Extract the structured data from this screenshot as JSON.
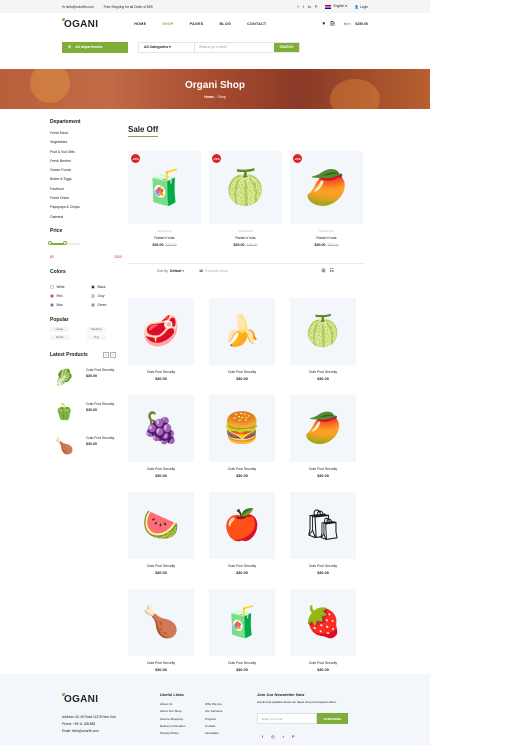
{
  "topbar": {
    "email": "hello@colorlib.com",
    "shipping": "Free Shipping for all Order of $99",
    "social": [
      "f",
      "t",
      "in",
      "P"
    ],
    "language": "English",
    "login": "Login"
  },
  "header": {
    "logo": "OGANI",
    "nav": [
      "HOME",
      "SHOP",
      "PAGES",
      "BLOG",
      "CONTACT"
    ],
    "item_label": "item:",
    "cart_total": "$150.00",
    "wishlist_count": "1",
    "cart_count": "3"
  },
  "search": {
    "departments_label": "All departments",
    "category": "All Categories",
    "placeholder": "What do yo u need?",
    "button": "SEARCH"
  },
  "hero": {
    "title": "Organi Shop",
    "breadcrumb_home": "Home",
    "breadcrumb_current": "Shop"
  },
  "sidebar": {
    "department_title": "Departement",
    "departments": [
      "Fresh Meat",
      "Vegetables",
      "Fruit & Nut Gifts",
      "Fresh Berries",
      "Ocean Foods",
      "Butter & Eggs",
      "Fastfood",
      "Fresh Onion",
      "Papayaya & Crisps",
      "Oatmeal"
    ],
    "price_title": "Price",
    "price_min": "$0",
    "price_max": "$100",
    "price_range": [
      0.0,
      0.5
    ],
    "colors_title": "Colors",
    "colors": [
      {
        "label": "White",
        "color": "#ffffff"
      },
      {
        "label": "Black",
        "color": "#1c1c1c"
      },
      {
        "label": "Red",
        "color": "#dd2222"
      },
      {
        "label": "Gray",
        "color": "#c4c4c4"
      },
      {
        "label": "Blue",
        "color": "#3c65dd"
      },
      {
        "label": "Green",
        "color": "#7fad39"
      }
    ],
    "popular_title": "Popular",
    "sizes": [
      "Large",
      "Medium",
      "Small",
      "Tiny"
    ],
    "latest_title": "Latest Products",
    "latest": [
      {
        "name": "Crab Pool Security",
        "price": "$30.00",
        "icon": "spinach-icon"
      },
      {
        "name": "Crab Pool Security",
        "price": "$30.00",
        "icon": "bell-pepper-icon"
      },
      {
        "name": "Crab Pool Security",
        "price": "$30.00",
        "icon": "chicken-leg-icon"
      }
    ]
  },
  "sale": {
    "title": "Sale Off",
    "items": [
      {
        "discount": "-20%",
        "category": "Dried Fruit",
        "name": "Raisin'n'nuts",
        "price": "$30.00",
        "old_price": "$36.00",
        "icon": "juice-icon"
      },
      {
        "discount": "-20%",
        "category": "Dried Fruit",
        "name": "Raisin'n'nuts",
        "price": "$30.00",
        "old_price": "$36.00",
        "icon": "guava-icon"
      },
      {
        "discount": "-20%",
        "category": "Dried Fruit",
        "name": "Raisin'n'nuts",
        "price": "$30.00",
        "old_price": "$36.00",
        "icon": "mango-icon"
      }
    ]
  },
  "filter": {
    "sort_label": "Sort By",
    "sort_value": "Default",
    "found_count": "16",
    "found_label": "Products found"
  },
  "products": [
    {
      "name": "Crab Pool Security",
      "price": "$30.00",
      "icon": "meat-icon"
    },
    {
      "name": "Crab Pool Security",
      "price": "$30.00",
      "icon": "banana-icon"
    },
    {
      "name": "Crab Pool Security",
      "price": "$30.00",
      "icon": "guava-icon"
    },
    {
      "name": "Crab Pool Security",
      "price": "$30.00",
      "icon": "grapes-icon"
    },
    {
      "name": "Crab Pool Security",
      "price": "$30.00",
      "icon": "burger-icon"
    },
    {
      "name": "Crab Pool Security",
      "price": "$30.00",
      "icon": "mango-icon"
    },
    {
      "name": "Crab Pool Security",
      "price": "$30.00",
      "icon": "watermelon-icon"
    },
    {
      "name": "Crab Pool Security",
      "price": "$30.00",
      "icon": "apple-icon"
    },
    {
      "name": "Crab Pool Security",
      "price": "$30.00",
      "icon": "raisin-bag-icon"
    },
    {
      "name": "Crab Pool Security",
      "price": "$30.00",
      "icon": "chicken-leg-icon"
    },
    {
      "name": "Crab Pool Security",
      "price": "$30.00",
      "icon": "juice-icon"
    },
    {
      "name": "Crab Pool Security",
      "price": "$30.00",
      "icon": "fruit-basket-icon"
    }
  ],
  "footer": {
    "logo": "OGANI",
    "address": "Address: 60-49 Road 11378 New York",
    "phone": "Phone: +65 11.188.888",
    "email": "Email: hello@colorlib.com",
    "links_title": "Useful Links",
    "links_col1": [
      "About Us",
      "About Our Shop",
      "Secure Shopping",
      "Delivery infomation",
      "Privacy Policy"
    ],
    "links_col2": [
      "Who We Are",
      "Our Services",
      "Projects",
      "Contact",
      "Innovation"
    ],
    "newsletter_title": "Join Our Newsletter Now",
    "newsletter_text": "Get E-mail updates about our latest shop and special offers.",
    "newsletter_placeholder": "Enter your mail",
    "newsletter_button": "SUBSCRIBE",
    "social": [
      "f",
      "◎",
      "t",
      "P"
    ]
  },
  "theme": {
    "accent": "#7fad39",
    "sale": "#dd2222"
  }
}
